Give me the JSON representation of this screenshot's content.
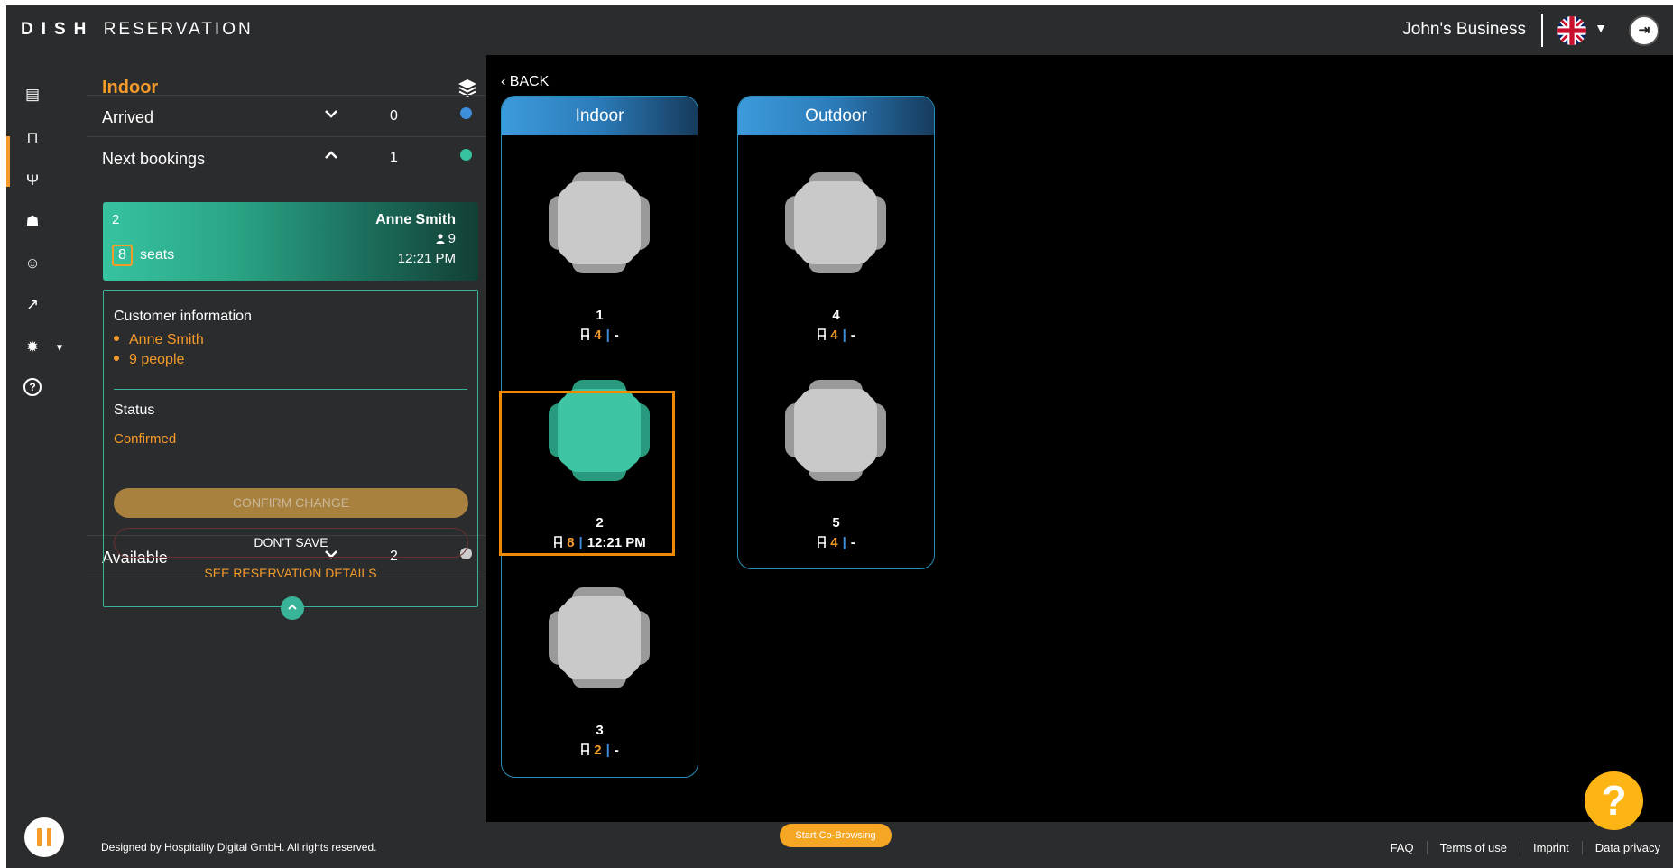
{
  "app": {
    "brand_bold": "DISH",
    "brand_light": "RESERVATION",
    "business_name": "John's Business",
    "logout_icon": "logout-icon"
  },
  "nav": {
    "items": [
      {
        "icon": "book-icon",
        "glyph": "▤"
      },
      {
        "icon": "table-icon",
        "glyph": "⊓",
        "active": true
      },
      {
        "icon": "cutlery-icon",
        "glyph": "Ψ"
      },
      {
        "icon": "users-icon",
        "glyph": "☗"
      },
      {
        "icon": "smiley-icon",
        "glyph": "☺"
      },
      {
        "icon": "chart-icon",
        "glyph": "↗"
      },
      {
        "icon": "settings-icon",
        "glyph": "✹"
      },
      {
        "icon": "help-circle-icon",
        "glyph": "?"
      }
    ],
    "settings_chevron": "▾"
  },
  "panel": {
    "title": "Indoor",
    "arrived": {
      "label": "Arrived",
      "count": "0",
      "chevron": "⌄",
      "color": "#3d8edb"
    },
    "next": {
      "label": "Next bookings",
      "count": "1",
      "chevron": "⌃",
      "color": "#37c3a0"
    },
    "available": {
      "label": "Available",
      "count": "2",
      "chevron": "⌄",
      "color": "#cccccc"
    },
    "booking": {
      "table": "2",
      "seats_count": "8",
      "seats_label": "seats",
      "name": "Anne Smith",
      "people": "9",
      "time": "12:21 PM"
    },
    "customer": {
      "title": "Customer information",
      "name": "Anne Smith",
      "people": "9 people",
      "status_label": "Status",
      "status_value": "Confirmed",
      "confirm_label": "CONFIRM CHANGE",
      "dont_save_label": "DON'T SAVE",
      "details_link": "SEE RESERVATION DETAILS"
    }
  },
  "main": {
    "back_label": "BACK",
    "areas": [
      {
        "name": "Indoor",
        "tables": [
          {
            "number": "1",
            "capacity": "4",
            "info": "-",
            "state": "free"
          },
          {
            "number": "2",
            "capacity": "8",
            "info": "12:21 PM",
            "state": "booked"
          },
          {
            "number": "3",
            "capacity": "2",
            "info": "-",
            "state": "free"
          }
        ]
      },
      {
        "name": "Outdoor",
        "tables": [
          {
            "number": "4",
            "capacity": "4",
            "info": "-",
            "state": "free"
          },
          {
            "number": "5",
            "capacity": "4",
            "info": "-",
            "state": "free"
          }
        ]
      }
    ],
    "selected_table": "2",
    "colors": {
      "free": "#c9c9c9",
      "free_chair": "#9a9a9a",
      "booked": "#3ec4a2",
      "booked_chair": "#2a9a7e",
      "accent": "#f49b2a",
      "selected": "#f08a00"
    }
  },
  "footer": {
    "copyright": "Designed by Hospitality Digital GmbH. All rights reserved.",
    "cobrowse": "Start Co-Browsing",
    "links": [
      "FAQ",
      "Terms of use",
      "Imprint",
      "Data privacy"
    ]
  },
  "help_fab": "?"
}
